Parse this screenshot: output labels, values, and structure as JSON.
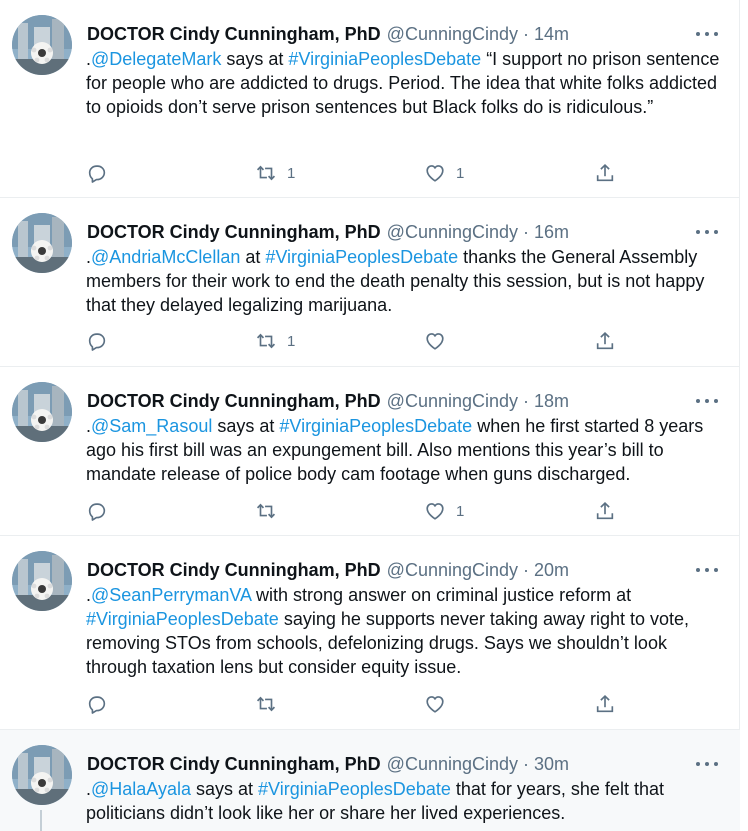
{
  "colors": {
    "link": "#1b95e0",
    "secondary": "#5b7083",
    "name": "#0f1419",
    "divider": "#ebeef0",
    "highlight_bg": "#f7f9fa"
  },
  "icons": {
    "reply": "speech-bubble",
    "retweet": "retweet-arrows",
    "like": "heart-outline",
    "share": "share-upload",
    "more": "three-dots"
  },
  "tweets": [
    {
      "name": "DOCTOR Cindy Cunningham, PhD",
      "handle": "@CunningCindy",
      "sep": "·",
      "time": "14m",
      "text": [
        {
          "t": ".",
          "link": false
        },
        {
          "t": "@DelegateMark",
          "link": true
        },
        {
          "t": " says at ",
          "link": false
        },
        {
          "t": "#VirginiaPeoplesDebate",
          "link": true
        },
        {
          "t": " “I support no prison sentence for people who are addicted to drugs. Period. The idea that white folks addicted to opioids don’t serve prison sentences but Black folks do is ridiculous.”",
          "link": false
        }
      ],
      "retweets": "1",
      "likes": "1"
    },
    {
      "name": "DOCTOR Cindy Cunningham, PhD",
      "handle": "@CunningCindy",
      "sep": "·",
      "time": "16m",
      "text": [
        {
          "t": ".",
          "link": false
        },
        {
          "t": "@AndriaMcClellan",
          "link": true
        },
        {
          "t": " at ",
          "link": false
        },
        {
          "t": "#VirginiaPeoplesDebate",
          "link": true
        },
        {
          "t": " thanks the General Assembly members  for their work to end the death penalty this session, but is not happy that they delayed legalizing marijuana.",
          "link": false
        }
      ],
      "retweets": "1",
      "likes": ""
    },
    {
      "name": "DOCTOR Cindy Cunningham, PhD",
      "handle": "@CunningCindy",
      "sep": "·",
      "time": "18m",
      "text": [
        {
          "t": ".",
          "link": false
        },
        {
          "t": "@Sam_Rasoul",
          "link": true
        },
        {
          "t": " says at ",
          "link": false
        },
        {
          "t": "#VirginiaPeoplesDebate",
          "link": true
        },
        {
          "t": " when he first started 8 years ago his first bill was an expungement bill. Also mentions this year’s bill to mandate release of police body cam footage when guns discharged.",
          "link": false
        }
      ],
      "retweets": "",
      "likes": "1"
    },
    {
      "name": "DOCTOR Cindy Cunningham, PhD",
      "handle": "@CunningCindy",
      "sep": "·",
      "time": "20m",
      "text": [
        {
          "t": ".",
          "link": false
        },
        {
          "t": "@SeanPerrymanVA",
          "link": true
        },
        {
          "t": " with strong answer on criminal justice reform at ",
          "link": false
        },
        {
          "t": "#VirginiaPeoplesDebate",
          "link": true
        },
        {
          "t": " saying he supports never taking away right to vote, removing STOs from schools, defelonizing drugs. Says we shouldn’t look through taxation lens but consider equity issue.",
          "link": false
        }
      ],
      "retweets": "",
      "likes": ""
    },
    {
      "name": "DOCTOR Cindy Cunningham, PhD",
      "handle": "@CunningCindy",
      "sep": "·",
      "time": "30m",
      "text": [
        {
          "t": ".",
          "link": false
        },
        {
          "t": "@HalaAyala",
          "link": true
        },
        {
          "t": " says at ",
          "link": false
        },
        {
          "t": "#VirginiaPeoplesDebate",
          "link": true
        },
        {
          "t": " that for years, she felt that politicians didn’t look like her or share her lived experiences.",
          "link": false
        }
      ],
      "retweets": "",
      "likes": ""
    }
  ]
}
